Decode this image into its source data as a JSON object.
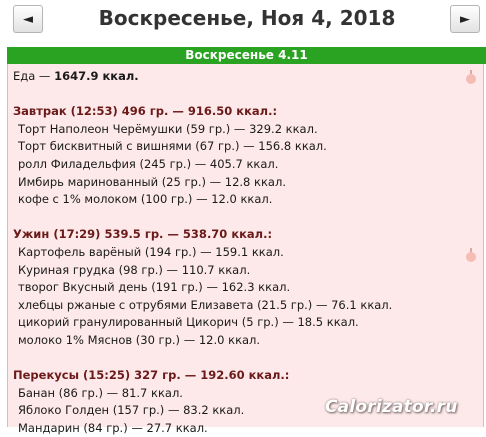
{
  "header": {
    "prev_label": "◄",
    "next_label": "►",
    "date_title": "Воскресенье, Ноя 4, 2018"
  },
  "day": {
    "label": "Воскресенье 4.11",
    "total_label": "Еда — ",
    "total_value": "1647.9 ккал."
  },
  "meals": [
    {
      "header": "Завтрак (12:53) 496 гр. — 916.50 ккал.:",
      "items": [
        "Торт Наполеон Черёмушки (59 гр.) — 329.2 ккал.",
        "Торт бисквитный с вишнями (67 гр.) — 156.8 ккал.",
        "ролл Филадельфия (245 гр.) — 405.7 ккал.",
        "Имбирь маринованный (25 гр.) — 12.8 ккал.",
        "кофе с 1% молоком (100 гр.) — 12.0 ккал."
      ]
    },
    {
      "header": "Ужин (17:29) 539.5 гр. — 538.70 ккал.:",
      "items": [
        "Картофель варёный (194 гр.) — 159.1 ккал.",
        "Куриная грудка (98 гр.) — 110.7 ккал.",
        "творог Вкусный день (191 гр.) — 162.3 ккал.",
        "хлебцы ржаные с отрубями Елизавета (21.5 гр.) — 76.1 ккал.",
        "цикорий гранулированный Цикорич (5 гр.) — 18.5 ккал.",
        "молоко 1% Мяснов (30 гр.) — 12.0 ккал."
      ]
    },
    {
      "header": "Перекусы (15:25) 327 гр. — 192.60 ккал.:",
      "items": [
        "Банан (86 гр.) — 81.7 ккал.",
        "Яблоко Голден (157 гр.) — 83.2 ккал.",
        "Мандарин (84 гр.) — 27.7 ккал."
      ]
    }
  ],
  "watermark": "Calorizator.ru",
  "icons": {
    "apple": "apple-icon"
  },
  "colors": {
    "header_green": "#2aa322",
    "panel_pink": "#fde9e9",
    "meal_header": "#6b1a1a"
  }
}
